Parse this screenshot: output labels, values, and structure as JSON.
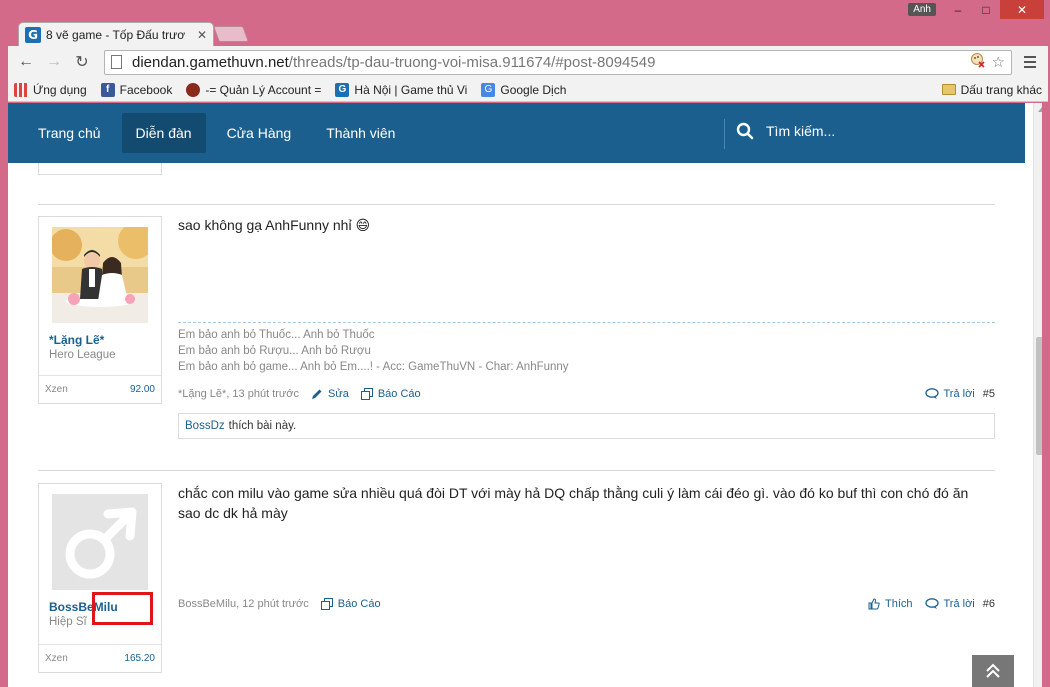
{
  "browser": {
    "user_badge": "Anh",
    "tab": {
      "favicon": "G",
      "title": "8 vẽ game - Tốp Đấu trươ"
    },
    "url_host": "diendan.gamethuvn.net",
    "url_path": "/threads/tp-dau-truong-voi-misa.911674/#post-8094549",
    "bookmarks": [
      {
        "label": "Ứng dụng",
        "icon": "apps-icon"
      },
      {
        "label": "Facebook",
        "icon": "facebook-icon"
      },
      {
        "label": "-= Quản Lý Account =",
        "icon": "game-icon"
      },
      {
        "label": "Hà Nội | Game thủ Vi",
        "icon": "gamethu-icon"
      },
      {
        "label": "Google Dịch",
        "icon": "translate-icon"
      }
    ],
    "other_bookmarks": "Dấu trang khác"
  },
  "nav": {
    "items": [
      "Trang chủ",
      "Diễn đàn",
      "Cửa Hàng",
      "Thành viên"
    ],
    "active_index": 1,
    "search_label": "Tìm kiếm..."
  },
  "posts": [
    {
      "username": "*Lặng Lẽ*",
      "user_title": "Hero League",
      "stat_label": "Xzen",
      "stat_value": "92.00",
      "message": "sao không gạ AnhFunny nhỉ",
      "emoji": "😄",
      "signature": [
        "Em bảo anh bỏ Thuốc... Anh bỏ Thuốc",
        "Em bảo anh bỏ Rượu... Anh bỏ Rượu",
        "Em bảo anh bỏ game... Anh bỏ Em....! - Acc: GameThuVN - Char: AnhFunny"
      ],
      "meta_author": "*Lặng Lẽ*, 13 phút trước",
      "edit_label": "Sửa",
      "report_label": "Báo Cáo",
      "reply_label": "Trả lời",
      "post_number": "#5",
      "liked_by": "BossDz",
      "liked_text": "thích bài này."
    },
    {
      "username": "BossBeMilu",
      "user_title": "Hiệp Sĩ",
      "stat_label": "Xzen",
      "stat_value": "165.20",
      "message": "chắc con milu vào game sửa nhiều quá đòi DT với mày hả DQ chấp thằng culi ý làm cái đéo gì. vào đó ko buf thì con chó đó ăn sao dc dk hả mày",
      "meta_author": "BossBeMilu, 12 phút trước",
      "report_label": "Báo Cáo",
      "like_label": "Thích",
      "reply_label": "Trả lời",
      "post_number": "#6"
    }
  ],
  "colors": {
    "navbar": "#1a5f8e",
    "navbar_active": "#134a70",
    "link": "#1a5f8e",
    "corner_ribbon": "#6ab42e",
    "highlight": "#e0141b",
    "window_frame": "#d46a8a"
  }
}
